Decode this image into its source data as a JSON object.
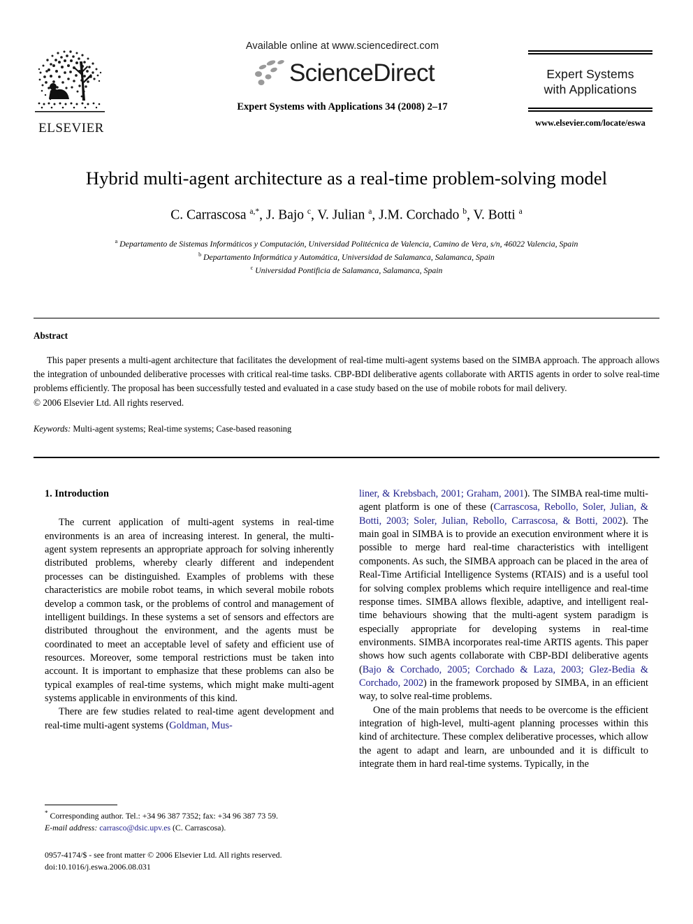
{
  "masthead": {
    "available_online": "Available online at www.sciencedirect.com",
    "sciencedirect_wordmark": "ScienceDirect",
    "journal_reference": "Expert Systems with Applications 34 (2008) 2–17",
    "publisher_name": "ELSEVIER",
    "journal_name_line1": "Expert Systems",
    "journal_name_line2": "with Applications",
    "journal_url": "www.elsevier.com/locate/eswa"
  },
  "title": "Hybrid multi-agent architecture as a real-time problem-solving model",
  "authors_html": "C. Carrascosa <sup>a,*</sup>, J. Bajo <sup>c</sup>, V. Julian <sup>a</sup>, J.M. Corchado <sup>b</sup>, V. Botti <sup>a</sup>",
  "affiliations": [
    "<sup>a</sup> Departamento de Sistemas Informáticos y Computación, Universidad Politécnica de Valencia, Camino de Vera, s/n, 46022 Valencia, Spain",
    "<sup>b</sup> Departamento Informática y Automática, Universidad de Salamanca, Salamanca, Spain",
    "<sup>c</sup> Universidad Pontificia de Salamanca, Salamanca, Spain"
  ],
  "abstract": {
    "heading": "Abstract",
    "body": "This paper presents a multi-agent architecture that facilitates the development of real-time multi-agent systems based on the SIMBA approach. The approach allows the integration of unbounded deliberative processes with critical real-time tasks. CBP-BDI deliberative agents collaborate with ARTIS agents in order to solve real-time problems efficiently. The proposal has been successfully tested and evaluated in a case study based on the use of mobile robots for mail delivery.",
    "copyright": "© 2006 Elsevier Ltd. All rights reserved.",
    "keywords_label": "Keywords:",
    "keywords_value": "Multi-agent systems; Real-time systems; Case-based reasoning"
  },
  "sections": {
    "introduction_heading": "1. Introduction",
    "left_paragraph_1": "The current application of multi-agent systems in real-time environments is an area of increasing interest. In general, the multi-agent system represents an appropriate approach for solving inherently distributed problems, whereby clearly different and independent processes can be distinguished. Examples of problems with these characteristics are mobile robot teams, in which several mobile robots develop a common task, or the problems of control and management of intelligent buildings. In these systems a set of sensors and effectors are distributed throughout the environment, and the agents must be coordinated to meet an acceptable level of safety and efficient use of resources. Moreover, some temporal restrictions must be taken into account. It is important to emphasize that these problems can also be typical examples of real-time systems, which might make multi-agent systems applicable in environments of this kind.",
    "left_paragraph_2_html": "There are few studies related to real-time agent development and real-time multi-agent systems (<span class=\"cite\">Goldman, Mus-</span>",
    "right_paragraph_1_html": "<span class=\"cite\">liner, &amp; Krebsbach, 2001; Graham, 2001</span>). The SIMBA real-time multi-agent platform is one of these (<span class=\"cite\">Carrascosa, Rebollo, Soler, Julian, &amp; Botti, 2003; Soler, Julian, Rebollo, Carrascosa, &amp; Botti, 2002</span>). The main goal in SIMBA is to provide an execution environment where it is possible to merge hard real-time characteristics with intelligent components. As such, the SIMBA approach can be placed in the area of Real-Time Artificial Intelligence Systems (RTAIS) and is a useful tool for solving complex problems which require intelligence and real-time response times. SIMBA allows flexible, adaptive, and intelligent real-time behaviours showing that the multi-agent system paradigm is especially appropriate for developing systems in real-time environments. SIMBA incorporates real-time ARTIS agents. This paper shows how such agents collaborate with CBP-BDI deliberative agents (<span class=\"cite\">Bajo &amp; Corchado, 2005; Corchado &amp; Laza, 2003; Glez-Bedia &amp; Corchado, 2002</span>) in the framework proposed by SIMBA, in an efficient way, to solve real-time problems.",
    "right_paragraph_2": "One of the main problems that needs to be overcome is the efficient integration of high-level, multi-agent planning processes within this kind of architecture. These complex deliberative processes, which allow the agent to adapt and learn, are unbounded and it is difficult to integrate them in hard real-time systems. Typically, in the"
  },
  "footnote": {
    "line1_html": "<sup>*</sup> Corresponding author. Tel.: +34 96 387 7352; fax: +34 96 387 73 59.",
    "email_label": "E-mail address:",
    "email_value": "carrasco@dsic.upv.es",
    "email_suffix": "(C. Carrascosa)."
  },
  "page_footer": {
    "issn_line": "0957-4174/$ - see front matter © 2006 Elsevier Ltd. All rights reserved.",
    "doi_line": "doi:10.1016/j.eswa.2006.08.031"
  },
  "colors": {
    "citation_blue": "#20208c",
    "text_black": "#000000",
    "page_background": "#ffffff"
  }
}
